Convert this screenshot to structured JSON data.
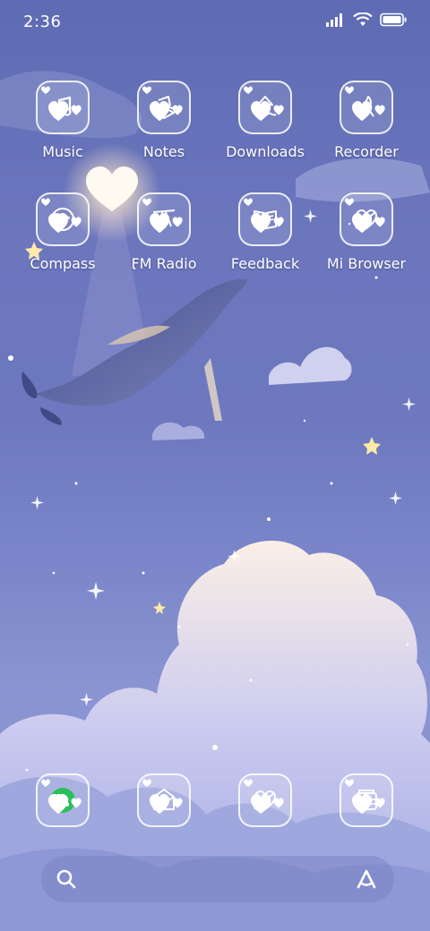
{
  "status_bar": {
    "time": "2:36"
  },
  "home_grid": {
    "row1": [
      {
        "label": "Music",
        "icon": "music-note-icon"
      },
      {
        "label": "Notes",
        "icon": "notes-icon"
      },
      {
        "label": "Downloads",
        "icon": "download-icon"
      },
      {
        "label": "Recorder",
        "icon": "microphone-icon"
      }
    ],
    "row2": [
      {
        "label": "Compass",
        "icon": "compass-icon"
      },
      {
        "label": "FM Radio",
        "icon": "radio-antenna-icon"
      },
      {
        "label": "Feedback",
        "icon": "book-icon"
      },
      {
        "label": "Mi Browser",
        "icon": "heart-arrow-icon"
      }
    ]
  },
  "dock": [
    {
      "icon": "phone-icon"
    },
    {
      "icon": "mail-icon"
    },
    {
      "icon": "heart-arrow-icon"
    },
    {
      "icon": "gallery-icon"
    }
  ],
  "colors": {
    "accent_green": "#27c25a",
    "label": "#ffffff"
  }
}
